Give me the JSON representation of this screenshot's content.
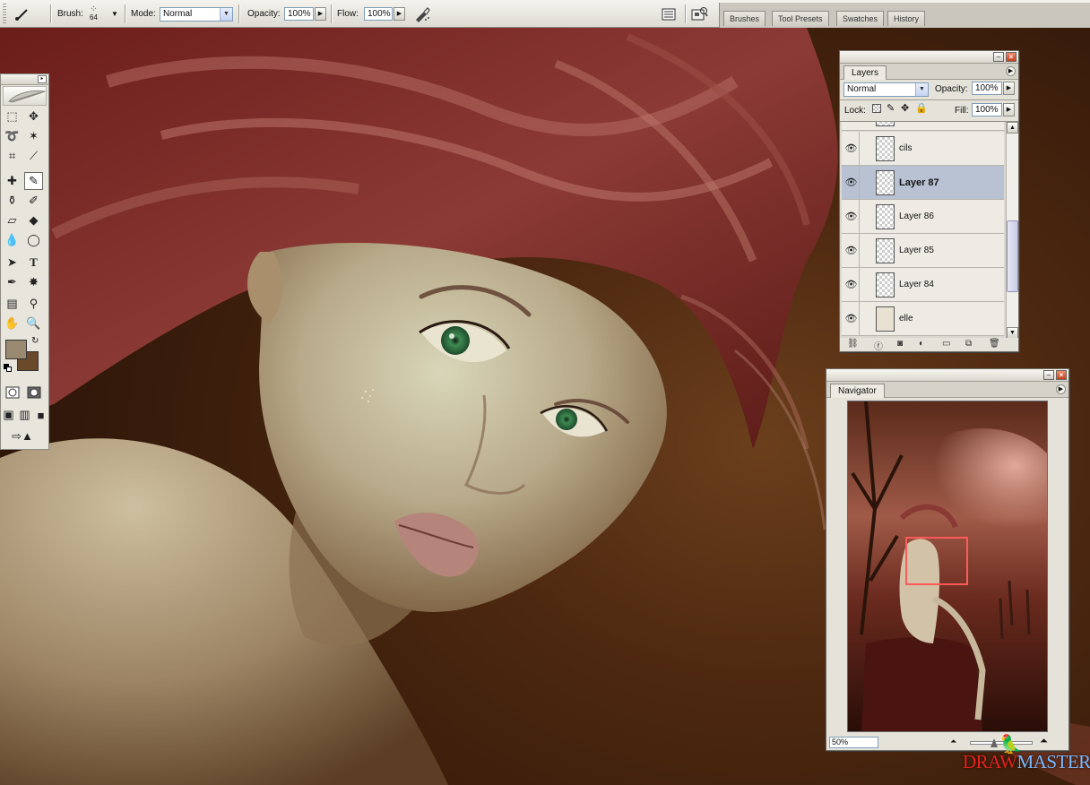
{
  "options_bar": {
    "brush_label": "Brush:",
    "brush_size": "64",
    "mode_label": "Mode:",
    "mode_value": "Normal",
    "opacity_label": "Opacity:",
    "opacity_value": "100%",
    "flow_label": "Flow:",
    "flow_value": "100%",
    "airbrush_icon": "airbrush-icon",
    "palette_well_icon": "palette-well-icon",
    "file_browser_icon": "file-browser-icon"
  },
  "palette_well": {
    "tabs": [
      "Brushes",
      "Tool Presets",
      "Swatches",
      "History"
    ]
  },
  "toolbox": {
    "foreground_color": "#9b8a72",
    "background_color": "#6b4a2c"
  },
  "layers_panel": {
    "tab_label": "Layers",
    "blend_mode": "Normal",
    "opacity_label": "Opacity:",
    "opacity_value": "100%",
    "lock_label": "Lock:",
    "fill_label": "Fill:",
    "fill_value": "100%",
    "layers": [
      {
        "name": "cils",
        "visible": true,
        "selected": false
      },
      {
        "name": "Layer 87",
        "visible": true,
        "selected": true
      },
      {
        "name": "Layer 86",
        "visible": true,
        "selected": false
      },
      {
        "name": "Layer 85",
        "visible": true,
        "selected": false
      },
      {
        "name": "Layer 84",
        "visible": true,
        "selected": false
      },
      {
        "name": "elle",
        "visible": true,
        "selected": false
      }
    ]
  },
  "navigator_panel": {
    "tab_label": "Navigator",
    "zoom_value": "50%"
  },
  "watermark": {
    "text_a": "DRA",
    "text_b": "W",
    "text_c": "MASTER.RU"
  },
  "colors": {
    "selection_highlight": "#b9c2d3",
    "navigator_view_box": "#ff5a5a",
    "watermark_red": "#e2221d"
  }
}
